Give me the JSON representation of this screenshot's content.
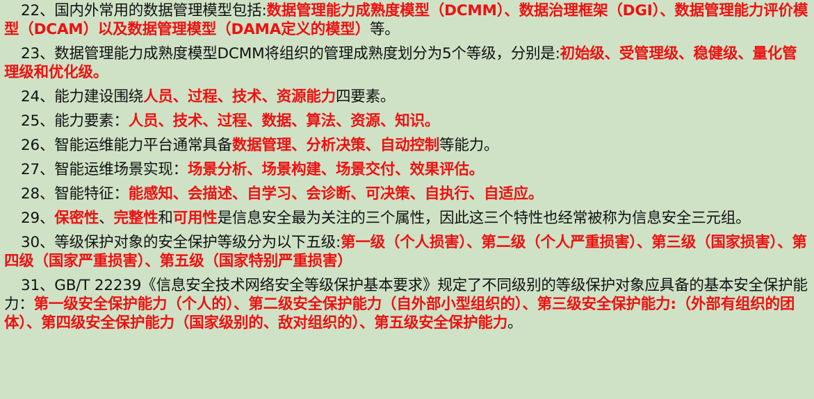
{
  "colors": {
    "background": "#cfe2c6",
    "text": "#111111",
    "highlight": "#ee1111"
  },
  "paragraphs": [
    {
      "segments": [
        {
          "t": "22、国内外常用的数据管理模型包括:",
          "h": false
        },
        {
          "t": "数据管理能力成熟度模型（DCMM）、数据治理框架（DGI）、数据管理能力评价模型（DCAM）以及数据管理模型（DAMA定义的模型）",
          "h": true
        },
        {
          "t": "等。",
          "h": false
        }
      ]
    },
    {
      "segments": [
        {
          "t": "23、数据管理能力成熟度模型DCMM将组织的管理成熟度划分为5个等级，分别是:",
          "h": false
        },
        {
          "t": "初始级、受管理级、稳健级、量化管理级和优化级",
          "h": true
        },
        {
          "t": "。",
          "h": false
        }
      ]
    },
    {
      "segments": [
        {
          "t": "24、能力建设围绕",
          "h": false
        },
        {
          "t": "人员、过程、技术、资源能力",
          "h": true
        },
        {
          "t": "四要素。",
          "h": false
        }
      ]
    },
    {
      "segments": [
        {
          "t": "25、能力要素：",
          "h": false
        },
        {
          "t": "人员、技术、过程、数据、算法、资源、知识",
          "h": true
        },
        {
          "t": "。",
          "h": false
        }
      ]
    },
    {
      "segments": [
        {
          "t": "26、智能运维能力平台通常具备",
          "h": false
        },
        {
          "t": "数据管理、分析决策、自动控制",
          "h": true
        },
        {
          "t": "等能力。",
          "h": false
        }
      ]
    },
    {
      "segments": [
        {
          "t": "27、智能运维场景实现：",
          "h": false
        },
        {
          "t": "场景分析、场景构建、场景交付、效果评估",
          "h": true
        },
        {
          "t": "。",
          "h": false
        }
      ]
    },
    {
      "segments": [
        {
          "t": "28、智能特征：",
          "h": false
        },
        {
          "t": "能感知、会描述、自学习、会诊断、可决策、自执行、自适应",
          "h": true
        },
        {
          "t": "。",
          "h": false
        }
      ]
    },
    {
      "segments": [
        {
          "t": "29、",
          "h": false
        },
        {
          "t": "保密性",
          "h": true
        },
        {
          "t": "、",
          "h": false
        },
        {
          "t": "完整性",
          "h": true
        },
        {
          "t": "和",
          "h": false
        },
        {
          "t": "可用性",
          "h": true
        },
        {
          "t": "是信息安全最为关注的三个属性，因此这三个特性也经常被称为信息安全三元组。",
          "h": false
        }
      ]
    },
    {
      "segments": [
        {
          "t": "30、等级保护对象的安全保护等级分为以下五级:",
          "h": false
        },
        {
          "t": "第一级（个人损害）、第二级（个人严重损害）、第三级（国家损害）、第四级（国家严重损害）、第五级（国家特别严重损害）",
          "h": true
        }
      ]
    },
    {
      "segments": [
        {
          "t": "31、GB/T 22239《信息安全技术网络安全等级保护基本要求》规定了不同级别的等级保护对象应具备的基本安全保护能力：",
          "h": false
        },
        {
          "t": "第一级安全保护能力（个人的）、第二级安全保护能力（自外部小型组织的）、第三级安全保护能力:（外部有组织的团体）、第四级安全保护能力（国家级别的、敌对组织的）、第五级安全保护能力",
          "h": true
        },
        {
          "t": "。",
          "h": false
        }
      ]
    }
  ]
}
